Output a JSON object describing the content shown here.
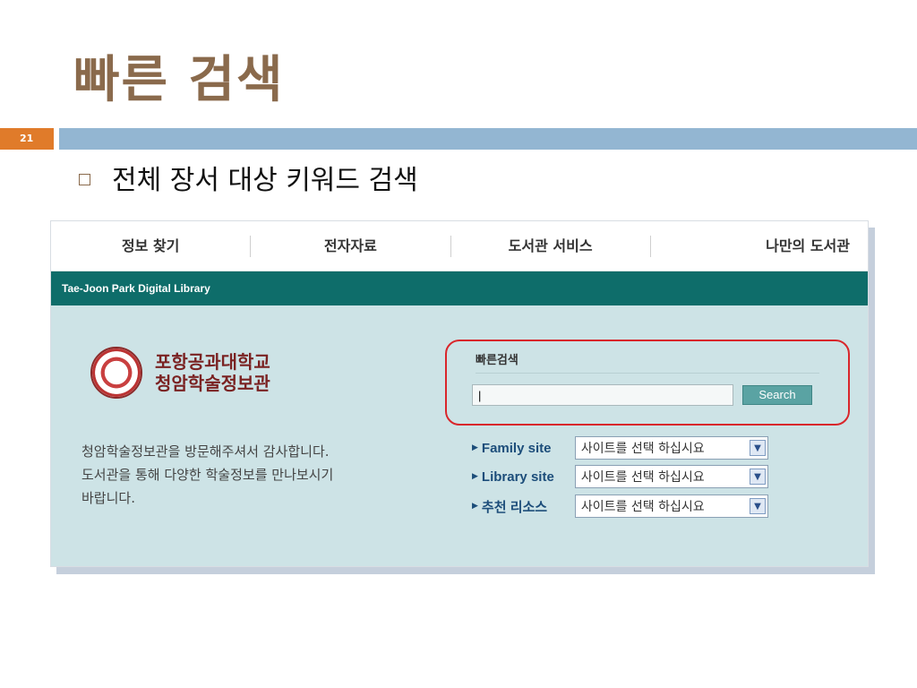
{
  "slide": {
    "title": "빠른 검색",
    "number": "21",
    "bullet": "전체 장서 대상 키워드 검색"
  },
  "nav": {
    "items": [
      "정보 찾기",
      "전자자료",
      "도서관 서비스",
      "나만의 도서관"
    ]
  },
  "banner": {
    "text": "Tae-Joon Park Digital Library"
  },
  "logo": {
    "line1": "포항공과대학교",
    "line2": "청암학술정보관"
  },
  "welcome": {
    "lines": [
      "청암학술정보관을 방문해주셔서 감사합니다.",
      "도서관을 통해 다양한 학술정보를 만나보시기",
      "바랍니다."
    ]
  },
  "quick_search": {
    "title": "빠른검색",
    "input_value": "|",
    "button_label": "Search",
    "highlight_color": "#d9262b"
  },
  "sites": [
    {
      "label": "Family site",
      "select": "사이트를 선택 하십시요"
    },
    {
      "label": "Library site",
      "select": "사이트를 선택 하십시요"
    },
    {
      "label": "추천 리소스",
      "select": "사이트를 선택 하십시요"
    }
  ],
  "colors": {
    "title": "#8a6a4c",
    "accent_bar": "#93b6d2",
    "number_bg": "#e07b2a",
    "banner": "#0e6d6a",
    "panel_bg": "#cde3e6"
  }
}
